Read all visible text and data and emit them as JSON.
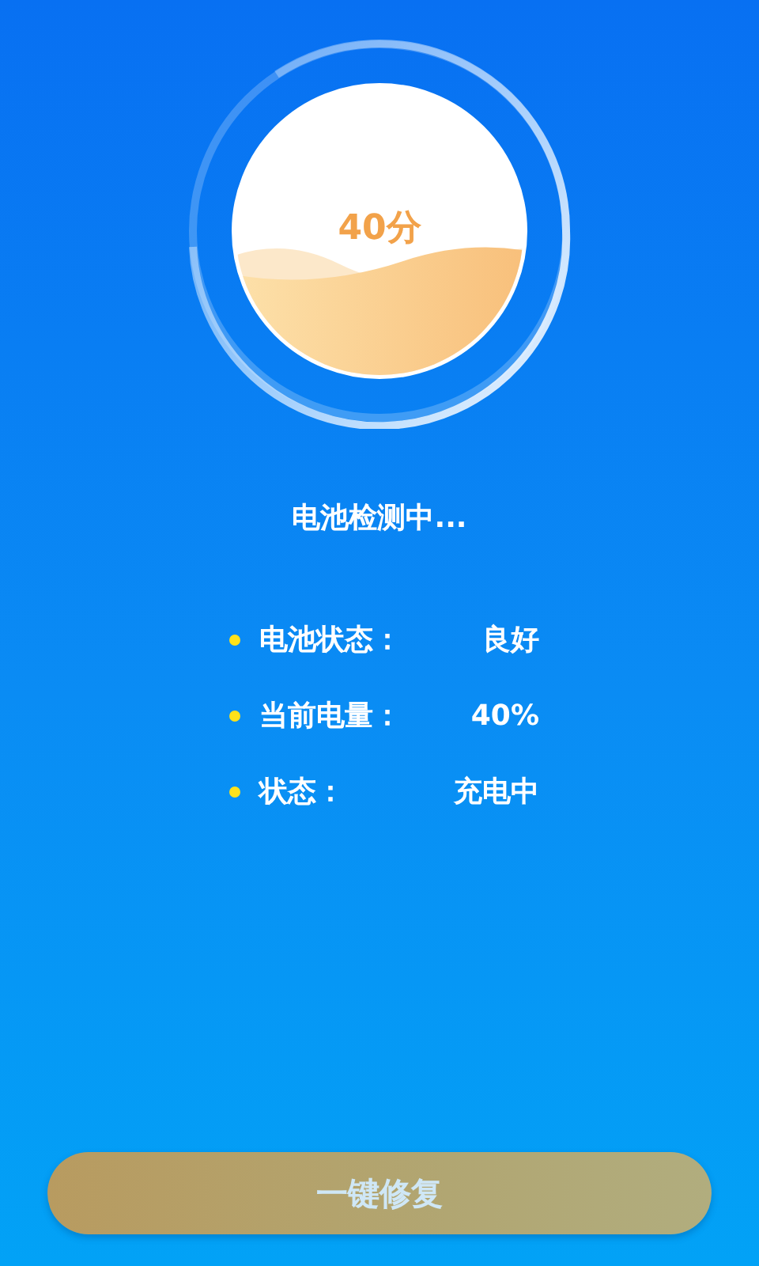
{
  "gauge": {
    "score": "40分"
  },
  "status_text": "电池检测中...",
  "details": [
    {
      "label": "电池状态：",
      "value": "良好"
    },
    {
      "label": "当前电量：",
      "value": "40%"
    },
    {
      "label": "状态：",
      "value": "充电中"
    }
  ],
  "repair_button": "一键修复"
}
